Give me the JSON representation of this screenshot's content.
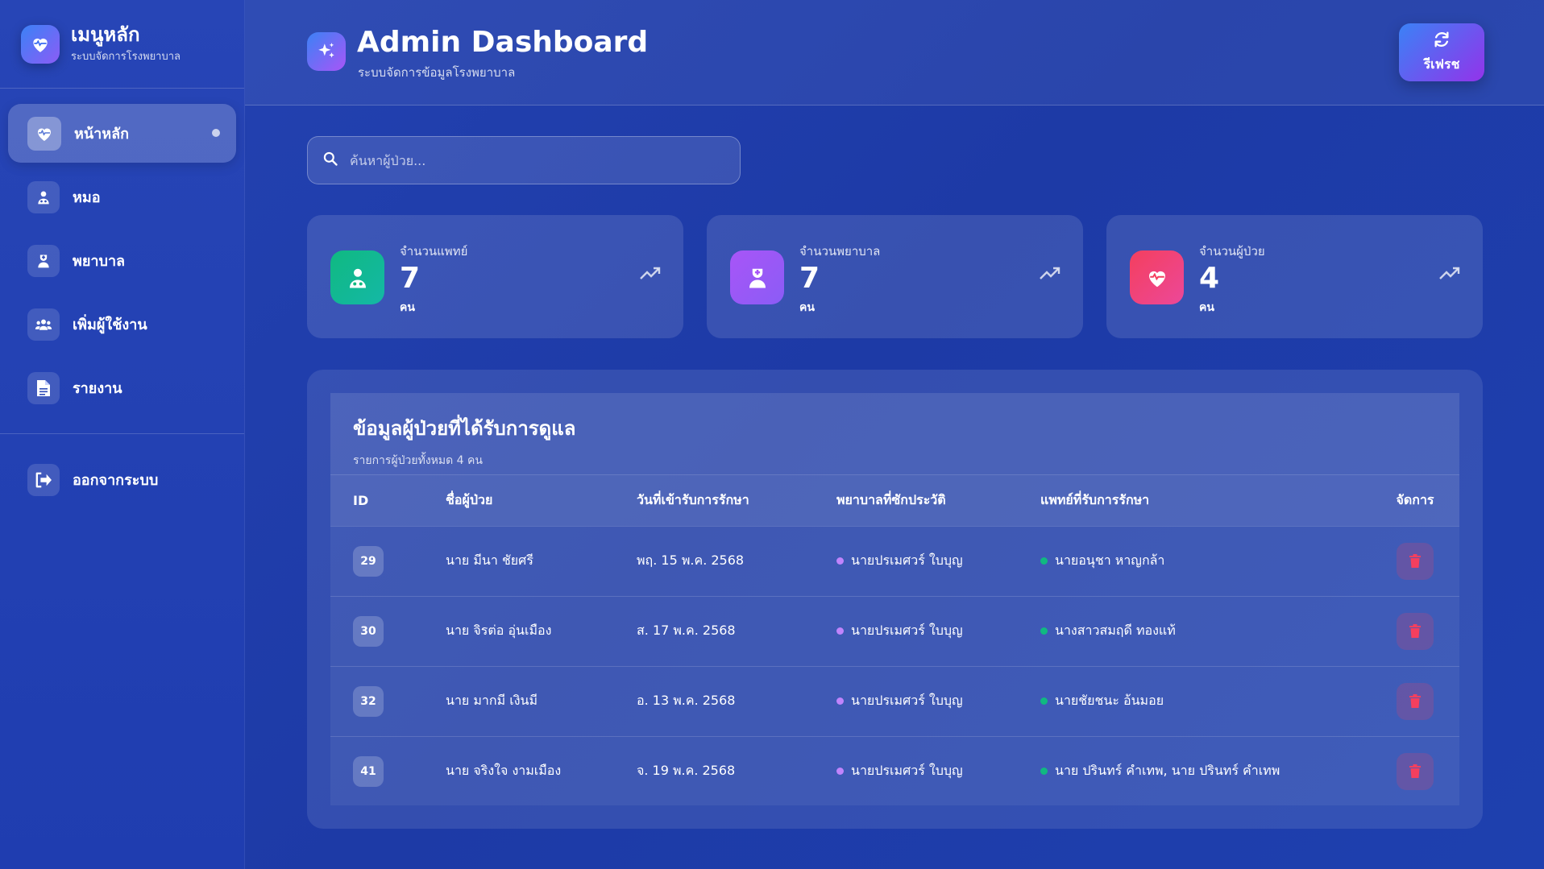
{
  "sidebar": {
    "brand_title": "เมนูหลัก",
    "brand_subtitle": "ระบบจัดการโรงพยาบาล",
    "items": [
      {
        "label": "หน้าหลัก",
        "icon": "heart-pulse-icon",
        "active": true
      },
      {
        "label": "หมอ",
        "icon": "doctor-icon"
      },
      {
        "label": "พยาบาล",
        "icon": "nurse-icon"
      },
      {
        "label": "เพิ่มผู้ใช้งาน",
        "icon": "users-icon"
      },
      {
        "label": "รายงาน",
        "icon": "document-icon"
      }
    ],
    "logout_label": "ออกจากระบบ"
  },
  "header": {
    "title": "Admin Dashboard",
    "subtitle": "ระบบจัดการข้อมูลโรงพยาบาล",
    "refresh_label": "รีเฟรช"
  },
  "search": {
    "placeholder": "ค้นหาผู้ป่วย..."
  },
  "stats": [
    {
      "label": "จำนวนแพทย์",
      "value": "7",
      "unit": "คน",
      "icon": "doctor-icon",
      "color": "#10b981"
    },
    {
      "label": "จำนวนพยาบาล",
      "value": "7",
      "unit": "คน",
      "icon": "nurse-icon",
      "color": "#a855f7"
    },
    {
      "label": "จำนวนผู้ป่วย",
      "value": "4",
      "unit": "คน",
      "icon": "heart-pulse-icon",
      "color": "#f43f5e"
    }
  ],
  "table": {
    "title": "ข้อมูลผู้ป่วยที่ได้รับการดูแล",
    "subtitle": "รายการผู้ป่วยทั้งหมด 4 คน",
    "columns": [
      "ID",
      "ชื่อผู้ป่วย",
      "วันที่เข้ารับการรักษา",
      "พยาบาลที่ซักประวัติ",
      "แพทย์ที่รับการรักษา",
      "จัดการ"
    ],
    "rows": [
      {
        "id": "29",
        "name": "นาย มีนา ชัยศรี",
        "date": "พฤ. 15 พ.ค. 2568",
        "nurse": "นายปรเมศวร์ ใบบุญ",
        "doctor": "นายอนุชา หาญกล้า"
      },
      {
        "id": "30",
        "name": "นาย จิรต่อ อุ่นเมือง",
        "date": "ส. 17 พ.ค. 2568",
        "nurse": "นายปรเมศวร์ ใบบุญ",
        "doctor": "นางสาวสมฤดี ทองแท้"
      },
      {
        "id": "32",
        "name": "นาย มากมี เงินมี",
        "date": "อ. 13 พ.ค. 2568",
        "nurse": "นายปรเมศวร์ ใบบุญ",
        "doctor": "นายชัยชนะ อ้นมอย"
      },
      {
        "id": "41",
        "name": "นาย จริงใจ งามเมือง",
        "date": "จ. 19 พ.ค. 2568",
        "nurse": "นายปรเมศวร์ ใบบุญ",
        "doctor": "นาย ปรินทร์ คำเทพ, นาย ปรินทร์ คำเทพ"
      }
    ]
  },
  "colors": {
    "nurse_dot": "#c084fc",
    "doctor_dot": "#10b981",
    "delete": "#f43f5e"
  }
}
